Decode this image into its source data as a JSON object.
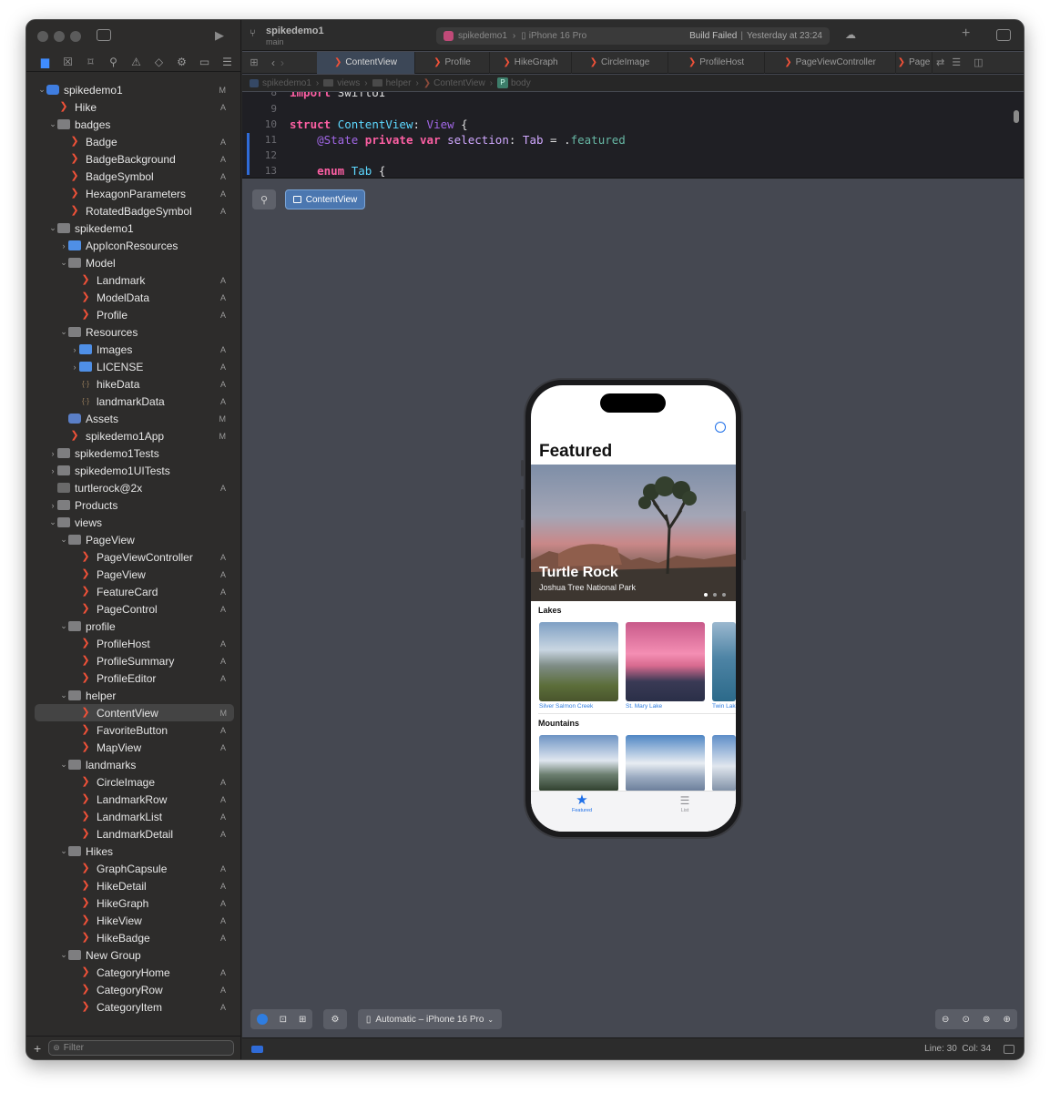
{
  "window": {
    "project_title": "spikedemo1",
    "branch": "main",
    "status_scheme": "spikedemo1",
    "status_device": "iPhone 16 Pro",
    "status_build": "Build Failed",
    "status_time": "Yesterday at 23:24"
  },
  "tabs": [
    {
      "label": "ContentView",
      "active": true
    },
    {
      "label": "Profile",
      "active": false
    },
    {
      "label": "HikeGraph",
      "active": false
    },
    {
      "label": "CircleImage",
      "active": false
    },
    {
      "label": "ProfileHost",
      "active": false
    },
    {
      "label": "PageViewController",
      "active": false
    },
    {
      "label": "Page",
      "active": false
    }
  ],
  "jumpbar": [
    "spikedemo1",
    "views",
    "helper",
    "ContentView",
    "body"
  ],
  "code_lines": [
    {
      "n": "8",
      "text": "import SwiftUI"
    },
    {
      "n": "9",
      "text": ""
    },
    {
      "n": "10",
      "text": "struct ContentView: View {"
    },
    {
      "n": "11",
      "text": "    @State private var selection: Tab = .featured"
    },
    {
      "n": "12",
      "text": ""
    },
    {
      "n": "13",
      "text": "    enum Tab {"
    }
  ],
  "preview_chip": "ContentView",
  "tree": [
    {
      "label": "spikedemo1",
      "indent": 0,
      "chev": "v",
      "icon": "proj",
      "badge": "M"
    },
    {
      "label": "Hike",
      "indent": 1,
      "chev": "",
      "icon": "swift",
      "badge": "A"
    },
    {
      "label": "badges",
      "indent": 1,
      "chev": "v",
      "icon": "folder",
      "badge": ""
    },
    {
      "label": "Badge",
      "indent": 2,
      "chev": "",
      "icon": "swift",
      "badge": "A"
    },
    {
      "label": "BadgeBackground",
      "indent": 2,
      "chev": "",
      "icon": "swift",
      "badge": "A"
    },
    {
      "label": "BadgeSymbol",
      "indent": 2,
      "chev": "",
      "icon": "swift",
      "badge": "A"
    },
    {
      "label": "HexagonParameters",
      "indent": 2,
      "chev": "",
      "icon": "swift",
      "badge": "A"
    },
    {
      "label": "RotatedBadgeSymbol",
      "indent": 2,
      "chev": "",
      "icon": "swift",
      "badge": "A"
    },
    {
      "label": "spikedemo1",
      "indent": 1,
      "chev": "v",
      "icon": "folder",
      "badge": ""
    },
    {
      "label": "AppIconResources",
      "indent": 2,
      "chev": ">",
      "icon": "folder blue",
      "badge": ""
    },
    {
      "label": "Model",
      "indent": 2,
      "chev": "v",
      "icon": "folder",
      "badge": ""
    },
    {
      "label": "Landmark",
      "indent": 3,
      "chev": "",
      "icon": "swift",
      "badge": "A"
    },
    {
      "label": "ModelData",
      "indent": 3,
      "chev": "",
      "icon": "swift",
      "badge": "A"
    },
    {
      "label": "Profile",
      "indent": 3,
      "chev": "",
      "icon": "swift",
      "badge": "A"
    },
    {
      "label": "Resources",
      "indent": 2,
      "chev": "v",
      "icon": "folder",
      "badge": ""
    },
    {
      "label": "Images",
      "indent": 3,
      "chev": ">",
      "icon": "folder blue",
      "badge": "A"
    },
    {
      "label": "LICENSE",
      "indent": 3,
      "chev": ">",
      "icon": "folder blue",
      "badge": "A"
    },
    {
      "label": "hikeData",
      "indent": 3,
      "chev": "",
      "icon": "json",
      "badge": "A"
    },
    {
      "label": "landmarkData",
      "indent": 3,
      "chev": "",
      "icon": "json",
      "badge": "A"
    },
    {
      "label": "Assets",
      "indent": 2,
      "chev": "",
      "icon": "asset",
      "badge": "M"
    },
    {
      "label": "spikedemo1App",
      "indent": 2,
      "chev": "",
      "icon": "swift",
      "badge": "M"
    },
    {
      "label": "spikedemo1Tests",
      "indent": 1,
      "chev": ">",
      "icon": "folder",
      "badge": ""
    },
    {
      "label": "spikedemo1UITests",
      "indent": 1,
      "chev": ">",
      "icon": "folder",
      "badge": ""
    },
    {
      "label": "turtlerock@2x",
      "indent": 1,
      "chev": "",
      "icon": "img",
      "badge": "A"
    },
    {
      "label": "Products",
      "indent": 1,
      "chev": ">",
      "icon": "folder",
      "badge": ""
    },
    {
      "label": "views",
      "indent": 1,
      "chev": "v",
      "icon": "folder",
      "badge": ""
    },
    {
      "label": "PageView",
      "indent": 2,
      "chev": "v",
      "icon": "folder",
      "badge": ""
    },
    {
      "label": "PageViewController",
      "indent": 3,
      "chev": "",
      "icon": "swift",
      "badge": "A"
    },
    {
      "label": "PageView",
      "indent": 3,
      "chev": "",
      "icon": "swift",
      "badge": "A"
    },
    {
      "label": "FeatureCard",
      "indent": 3,
      "chev": "",
      "icon": "swift",
      "badge": "A"
    },
    {
      "label": "PageControl",
      "indent": 3,
      "chev": "",
      "icon": "swift",
      "badge": "A"
    },
    {
      "label": "profile",
      "indent": 2,
      "chev": "v",
      "icon": "folder",
      "badge": ""
    },
    {
      "label": "ProfileHost",
      "indent": 3,
      "chev": "",
      "icon": "swift",
      "badge": "A"
    },
    {
      "label": "ProfileSummary",
      "indent": 3,
      "chev": "",
      "icon": "swift",
      "badge": "A"
    },
    {
      "label": "ProfileEditor",
      "indent": 3,
      "chev": "",
      "icon": "swift",
      "badge": "A"
    },
    {
      "label": "helper",
      "indent": 2,
      "chev": "v",
      "icon": "folder",
      "badge": ""
    },
    {
      "label": "ContentView",
      "indent": 3,
      "chev": "",
      "icon": "swift",
      "badge": "M",
      "selected": true
    },
    {
      "label": "FavoriteButton",
      "indent": 3,
      "chev": "",
      "icon": "swift",
      "badge": "A"
    },
    {
      "label": "MapView",
      "indent": 3,
      "chev": "",
      "icon": "swift",
      "badge": "A"
    },
    {
      "label": "landmarks",
      "indent": 2,
      "chev": "v",
      "icon": "folder",
      "badge": ""
    },
    {
      "label": "CircleImage",
      "indent": 3,
      "chev": "",
      "icon": "swift",
      "badge": "A"
    },
    {
      "label": "LandmarkRow",
      "indent": 3,
      "chev": "",
      "icon": "swift",
      "badge": "A"
    },
    {
      "label": "LandmarkList",
      "indent": 3,
      "chev": "",
      "icon": "swift",
      "badge": "A"
    },
    {
      "label": "LandmarkDetail",
      "indent": 3,
      "chev": "",
      "icon": "swift",
      "badge": "A"
    },
    {
      "label": "Hikes",
      "indent": 2,
      "chev": "v",
      "icon": "folder",
      "badge": ""
    },
    {
      "label": "GraphCapsule",
      "indent": 3,
      "chev": "",
      "icon": "swift",
      "badge": "A"
    },
    {
      "label": "HikeDetail",
      "indent": 3,
      "chev": "",
      "icon": "swift",
      "badge": "A"
    },
    {
      "label": "HikeGraph",
      "indent": 3,
      "chev": "",
      "icon": "swift",
      "badge": "A"
    },
    {
      "label": "HikeView",
      "indent": 3,
      "chev": "",
      "icon": "swift",
      "badge": "A"
    },
    {
      "label": "HikeBadge",
      "indent": 3,
      "chev": "",
      "icon": "swift",
      "badge": "A"
    },
    {
      "label": "New Group",
      "indent": 2,
      "chev": "v",
      "icon": "folder",
      "badge": ""
    },
    {
      "label": "CategoryHome",
      "indent": 3,
      "chev": "",
      "icon": "swift",
      "badge": "A"
    },
    {
      "label": "CategoryRow",
      "indent": 3,
      "chev": "",
      "icon": "swift",
      "badge": "A"
    },
    {
      "label": "CategoryItem",
      "indent": 3,
      "chev": "",
      "icon": "swift",
      "badge": "A"
    }
  ],
  "filter_placeholder": "Filter",
  "app": {
    "nav_title": "Featured",
    "hero_title": "Turtle Rock",
    "hero_subtitle": "Joshua Tree National Park",
    "page_dots": 3,
    "sections": [
      {
        "title": "Lakes",
        "items": [
          "Silver Salmon Creek",
          "St. Mary Lake",
          "Twin Lake"
        ]
      },
      {
        "title": "Mountains",
        "items": [
          "",
          "",
          ""
        ]
      }
    ],
    "tab_featured": "Featured",
    "tab_list": "List"
  },
  "device_selector": "Automatic – iPhone 16 Pro",
  "cursor_position": "Line: 30  Col: 34",
  "colors": {
    "accent": "#3f8cff",
    "swift": "#f05138",
    "canvas": "#454851"
  }
}
